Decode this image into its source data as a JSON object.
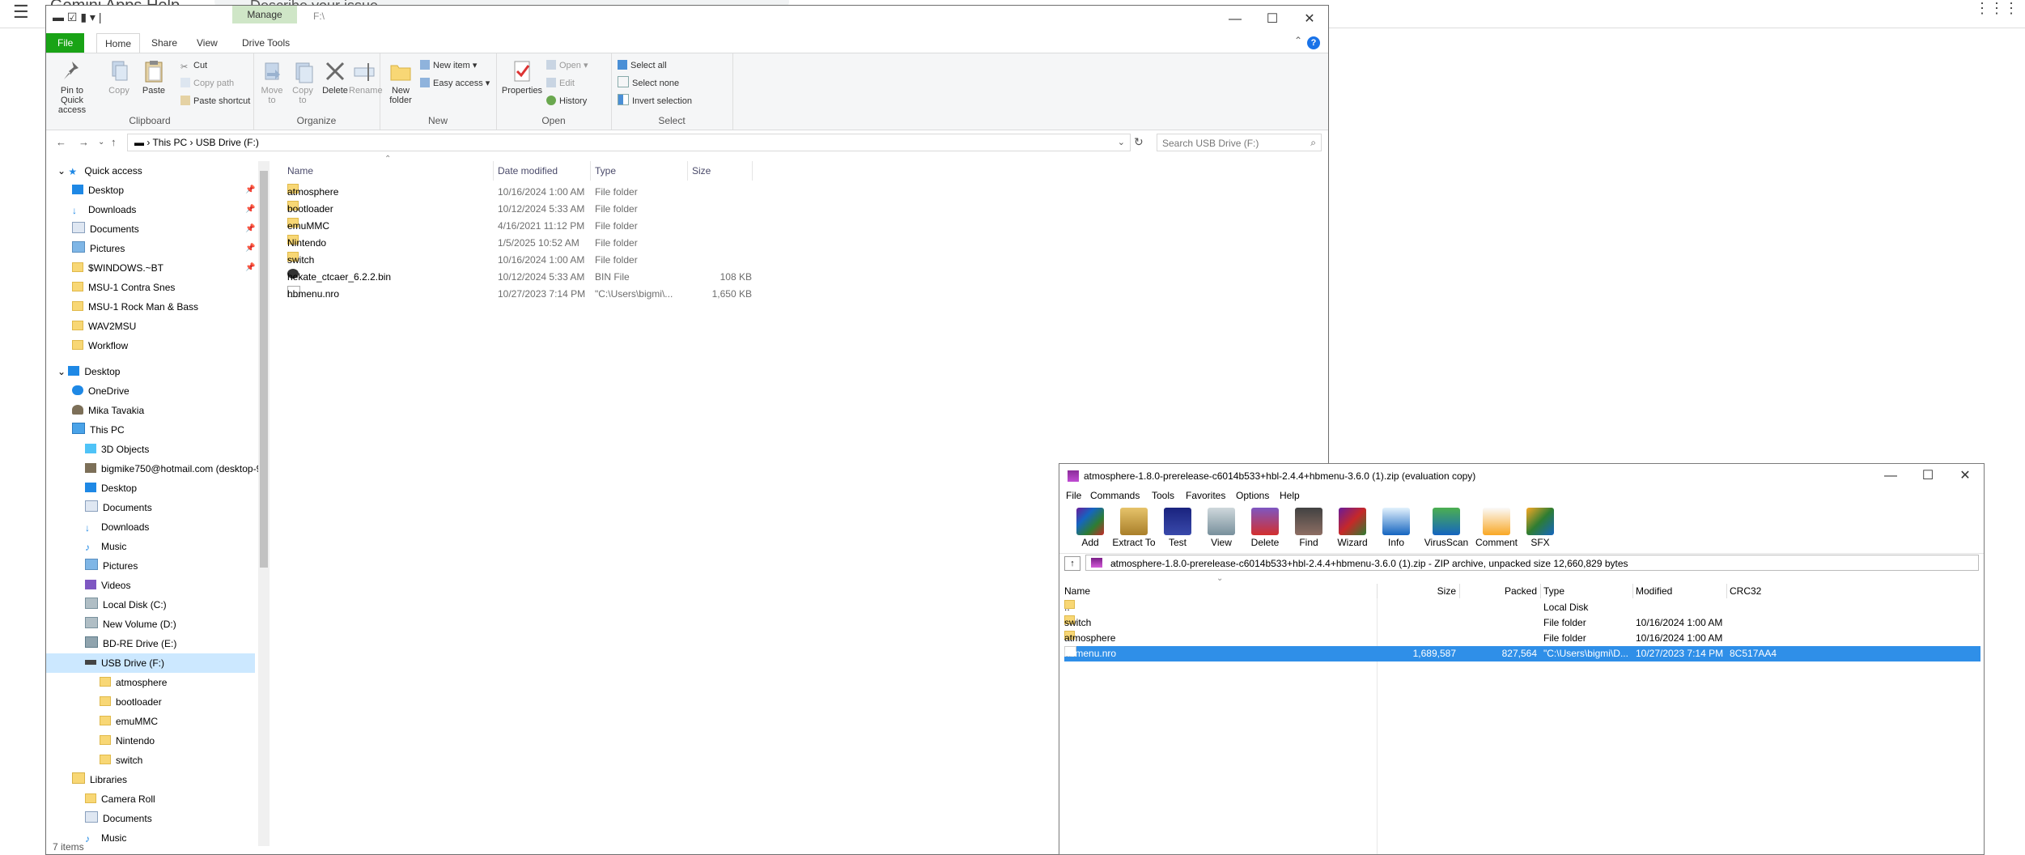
{
  "background_app": {
    "title": "Gemini Apps Help",
    "search_placeholder": "Describe your issue"
  },
  "explorer": {
    "title_path": "F:\\",
    "manage_tab": "Manage",
    "tabs": [
      "File",
      "Home",
      "Share",
      "View",
      "Drive Tools"
    ],
    "ribbon": {
      "clipboard": {
        "label": "Clipboard",
        "pin": "Pin to Quick access",
        "copy": "Copy",
        "paste": "Paste",
        "cut": "Cut",
        "copy_path": "Copy path",
        "paste_shortcut": "Paste shortcut"
      },
      "organize": {
        "label": "Organize",
        "move_to": "Move to",
        "copy_to": "Copy to",
        "delete": "Delete",
        "rename": "Rename"
      },
      "new": {
        "label": "New",
        "new_folder": "New folder",
        "new_item": "New item",
        "easy_access": "Easy access"
      },
      "open": {
        "label": "Open",
        "properties": "Properties",
        "open": "Open",
        "edit": "Edit",
        "history": "History"
      },
      "select": {
        "label": "Select",
        "select_all": "Select all",
        "select_none": "Select none",
        "invert": "Invert selection"
      }
    },
    "breadcrumbs": [
      "This PC",
      "USB Drive (F:)"
    ],
    "search_placeholder": "Search USB Drive (F:)",
    "nav": {
      "quick_access": "Quick access",
      "quick_items": [
        "Desktop",
        "Downloads",
        "Documents",
        "Pictures",
        "$WINDOWS.~BT",
        "MSU-1 Contra Snes",
        "MSU-1 Rock Man & Bass",
        "WAV2MSU",
        "Workflow"
      ],
      "desktop": "Desktop",
      "desktop_items": [
        "OneDrive",
        "Mika Tavakia",
        "This PC"
      ],
      "thispc_items": [
        "3D Objects",
        "bigmike750@hotmail.com (desktop-9",
        "Desktop",
        "Documents",
        "Downloads",
        "Music",
        "Pictures",
        "Videos",
        "Local Disk (C:)",
        "New Volume (D:)",
        "BD-RE Drive (E:)",
        "USB Drive (F:)"
      ],
      "usb_children": [
        "atmosphere",
        "bootloader",
        "emuMMC",
        "Nintendo",
        "switch"
      ],
      "libraries": "Libraries",
      "library_items": [
        "Camera Roll",
        "Documents",
        "Music"
      ]
    },
    "columns": {
      "name": "Name",
      "date": "Date modified",
      "type": "Type",
      "size": "Size"
    },
    "files": [
      {
        "name": "atmosphere",
        "date": "10/16/2024 1:00 AM",
        "type": "File folder",
        "size": "",
        "kind": "folder"
      },
      {
        "name": "bootloader",
        "date": "10/12/2024 5:33 AM",
        "type": "File folder",
        "size": "",
        "kind": "folder"
      },
      {
        "name": "emuMMC",
        "date": "4/16/2021 11:12 PM",
        "type": "File folder",
        "size": "",
        "kind": "folder"
      },
      {
        "name": "Nintendo",
        "date": "1/5/2025 10:52 AM",
        "type": "File folder",
        "size": "",
        "kind": "folder"
      },
      {
        "name": "switch",
        "date": "10/16/2024 1:00 AM",
        "type": "File folder",
        "size": "",
        "kind": "folder"
      },
      {
        "name": "hekate_ctcaer_6.2.2.bin",
        "date": "10/12/2024 5:33 AM",
        "type": "BIN File",
        "size": "108 KB",
        "kind": "bin"
      },
      {
        "name": "hbmenu.nro",
        "date": "10/27/2023 7:14 PM",
        "type": "\"C:\\Users\\bigmi\\...",
        "size": "1,650 KB",
        "kind": "file"
      }
    ],
    "status": "7 items"
  },
  "winrar": {
    "title": "atmosphere-1.8.0-prerelease-c6014b533+hbl-2.4.4+hbmenu-3.6.0 (1).zip (evaluation copy)",
    "menu": [
      "File",
      "Commands",
      "Tools",
      "Favorites",
      "Options",
      "Help"
    ],
    "toolbar": [
      "Add",
      "Extract To",
      "Test",
      "View",
      "Delete",
      "Find",
      "Wizard",
      "Info",
      "VirusScan",
      "Comment",
      "SFX"
    ],
    "path": "atmosphere-1.8.0-prerelease-c6014b533+hbl-2.4.4+hbmenu-3.6.0 (1).zip - ZIP archive, unpacked size 12,660,829 bytes",
    "columns": {
      "name": "Name",
      "size": "Size",
      "packed": "Packed",
      "type": "Type",
      "modified": "Modified",
      "crc": "CRC32"
    },
    "rows": [
      {
        "name": "..",
        "size": "",
        "packed": "",
        "type": "Local Disk",
        "modified": "",
        "crc": "",
        "kind": "up"
      },
      {
        "name": "switch",
        "size": "",
        "packed": "",
        "type": "File folder",
        "modified": "10/16/2024 1:00 AM",
        "crc": "",
        "kind": "folder"
      },
      {
        "name": "atmosphere",
        "size": "",
        "packed": "",
        "type": "File folder",
        "modified": "10/16/2024 1:00 AM",
        "crc": "",
        "kind": "folder"
      },
      {
        "name": "hbmenu.nro",
        "size": "1,689,587",
        "packed": "827,564",
        "type": "\"C:\\Users\\bigmi\\D...",
        "modified": "10/27/2023 7:14 PM",
        "crc": "8C517AA4",
        "kind": "file",
        "selected": true
      }
    ]
  }
}
